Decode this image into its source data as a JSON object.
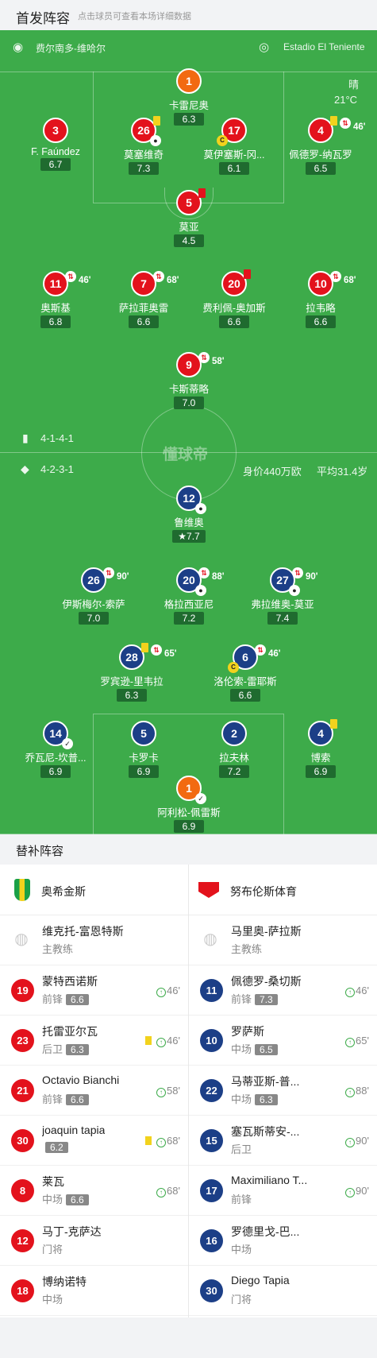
{
  "header": {
    "title": "首发阵容",
    "subtitle": "点击球员可查看本场详细数据"
  },
  "match": {
    "home_team": "费尔南多-维哈尔",
    "stadium": "Estadio El Teniente",
    "weather": "晴",
    "temp": "21°C"
  },
  "home": {
    "formation": "4-1-4-1"
  },
  "away": {
    "formation": "4-2-3-1",
    "value": "身价440万欧",
    "age": "平均31.4岁"
  },
  "watermark": "懂球帝",
  "home_players": [
    {
      "num": "1",
      "name": "卡雷尼奥",
      "rating": "6.3"
    },
    {
      "num": "3",
      "name": "F. Faúndez",
      "rating": "6.7"
    },
    {
      "num": "26",
      "name": "莫塞维奇",
      "rating": "7.3"
    },
    {
      "num": "17",
      "name": "莫伊塞斯-冈...",
      "rating": "6.1"
    },
    {
      "num": "4",
      "name": "佩德罗-纳瓦罗",
      "rating": "6.5",
      "min": "46'"
    },
    {
      "num": "5",
      "name": "莫亚",
      "rating": "4.5"
    },
    {
      "num": "11",
      "name": "奥斯基",
      "rating": "6.8",
      "min": "46'"
    },
    {
      "num": "7",
      "name": "萨拉菲奥雷",
      "rating": "6.6",
      "min": "68'"
    },
    {
      "num": "20",
      "name": "费利佩-奥加斯",
      "rating": "6.6"
    },
    {
      "num": "10",
      "name": "拉韦略",
      "rating": "6.6",
      "min": "68'"
    },
    {
      "num": "9",
      "name": "卡斯蒂略",
      "rating": "7.0",
      "min": "58'"
    }
  ],
  "away_players": [
    {
      "num": "12",
      "name": "鲁维奥",
      "rating": "7.7"
    },
    {
      "num": "26",
      "name": "伊斯梅尔-索萨",
      "rating": "7.0",
      "min": "90'"
    },
    {
      "num": "20",
      "name": "格拉西亚尼",
      "rating": "7.2",
      "min": "88'"
    },
    {
      "num": "27",
      "name": "弗拉维奥-莫亚",
      "rating": "7.4",
      "min": "90'"
    },
    {
      "num": "28",
      "name": "罗宾逊-里韦拉",
      "rating": "6.3",
      "min": "65'"
    },
    {
      "num": "6",
      "name": "洛伦索-雷耶斯",
      "rating": "6.6",
      "min": "46'"
    },
    {
      "num": "14",
      "name": "乔瓦尼-坎普...",
      "rating": "6.9"
    },
    {
      "num": "5",
      "name": "卡罗卡",
      "rating": "6.9"
    },
    {
      "num": "2",
      "name": "拉夫林",
      "rating": "7.2"
    },
    {
      "num": "4",
      "name": "博索",
      "rating": "6.9"
    },
    {
      "num": "1",
      "name": "阿利松-佩雷斯",
      "rating": "6.9"
    }
  ],
  "subs": {
    "title": "替补阵容",
    "home_team": "奥希金斯",
    "away_team": "努布伦斯体育",
    "home": [
      {
        "num": "",
        "name": "维克托-富恩特斯",
        "pos": "主教练",
        "rating": "",
        "min": ""
      },
      {
        "num": "19",
        "name": "蒙特西诺斯",
        "pos": "前锋",
        "rating": "6.6",
        "min": "46'"
      },
      {
        "num": "23",
        "name": "托雷亚尔瓦",
        "pos": "后卫",
        "rating": "6.3",
        "min": "46'"
      },
      {
        "num": "21",
        "name": "Octavio Bianchi",
        "pos": "前锋",
        "rating": "6.6",
        "min": "58'"
      },
      {
        "num": "30",
        "name": "joaquin tapia",
        "pos": "",
        "rating": "6.2",
        "min": "68'"
      },
      {
        "num": "8",
        "name": "莱瓦",
        "pos": "中场",
        "rating": "6.6",
        "min": "68'"
      },
      {
        "num": "12",
        "name": "马丁-克萨达",
        "pos": "门将",
        "rating": "",
        "min": ""
      },
      {
        "num": "18",
        "name": "博纳诺特",
        "pos": "中场",
        "rating": "",
        "min": ""
      }
    ],
    "away": [
      {
        "num": "",
        "name": "马里奥-萨拉斯",
        "pos": "主教练",
        "rating": "",
        "min": ""
      },
      {
        "num": "11",
        "name": "佩德罗-桑切斯",
        "pos": "前锋",
        "rating": "7.3",
        "min": "46'"
      },
      {
        "num": "10",
        "name": "罗萨斯",
        "pos": "中场",
        "rating": "6.5",
        "min": "65'"
      },
      {
        "num": "22",
        "name": "马蒂亚斯-普...",
        "pos": "中场",
        "rating": "6.3",
        "min": "88'"
      },
      {
        "num": "15",
        "name": "塞瓦斯蒂安-...",
        "pos": "后卫",
        "rating": "",
        "min": "90'"
      },
      {
        "num": "17",
        "name": "Maximiliano T...",
        "pos": "前锋",
        "rating": "",
        "min": "90'"
      },
      {
        "num": "16",
        "name": "罗德里戈-巴...",
        "pos": "中场",
        "rating": "",
        "min": ""
      },
      {
        "num": "30",
        "name": "Diego Tapia",
        "pos": "门将",
        "rating": "",
        "min": ""
      }
    ]
  },
  "colors": {
    "pitch": "#3dab4a",
    "home": "#e3121c",
    "away": "#1c3f87",
    "gk": "#f26a11"
  }
}
